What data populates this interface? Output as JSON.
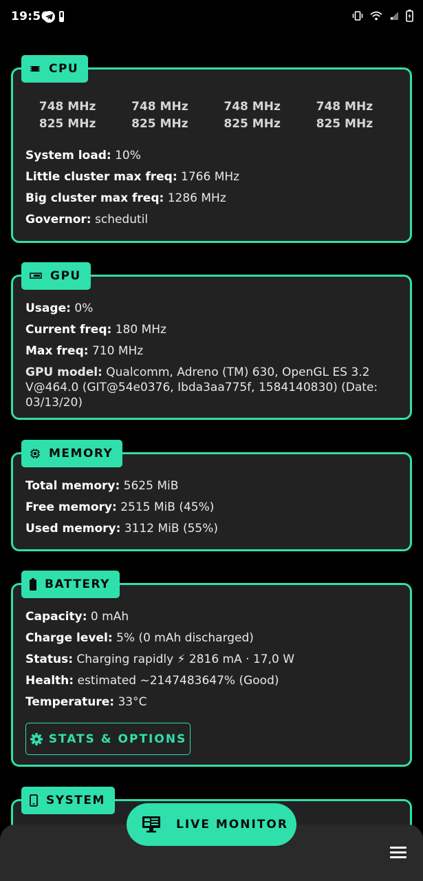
{
  "status_bar": {
    "time": "19:56",
    "icons": [
      "telegram-icon",
      "battery-small-icon",
      "vibrate-icon",
      "wifi-icon",
      "signal-icon",
      "battery-icon"
    ]
  },
  "colors": {
    "accent": "#2fe0ad",
    "card_bg": "#222222",
    "page_bg": "#000000"
  },
  "cpu": {
    "title": "CPU",
    "cores": [
      {
        "cur": "748 MHz",
        "max": "825 MHz"
      },
      {
        "cur": "748 MHz",
        "max": "825 MHz"
      },
      {
        "cur": "748 MHz",
        "max": "825 MHz"
      },
      {
        "cur": "748 MHz",
        "max": "825 MHz"
      }
    ],
    "system_load_label": "System load:",
    "system_load": "10%",
    "little_label": "Little cluster max freq:",
    "little": "1766 MHz",
    "big_label": "Big cluster max freq:",
    "big": "1286 MHz",
    "governor_label": "Governor:",
    "governor": "schedutil"
  },
  "gpu": {
    "title": "GPU",
    "usage_label": "Usage:",
    "usage": "0%",
    "current_label": "Current freq:",
    "current": "180 MHz",
    "max_label": "Max freq:",
    "max": "710 MHz",
    "model_label": "GPU model:",
    "model": "Qualcomm, Adreno (TM) 630, OpenGL ES 3.2 V@464.0 (GIT@54e0376, Ibda3aa775f, 1584140830) (Date: 03/13/20)"
  },
  "memory": {
    "title": "MEMORY",
    "total_label": "Total memory:",
    "total": "5625 MiB",
    "free_label": "Free memory:",
    "free": "2515 MiB (45%)",
    "used_label": "Used memory:",
    "used": "3112 MiB (55%)"
  },
  "battery": {
    "title": "BATTERY",
    "capacity_label": "Capacity:",
    "capacity": "0 mAh",
    "charge_label": "Charge level:",
    "charge": "5% (0 mAh discharged)",
    "status_label": "Status:",
    "status": "Charging rapidly ⚡ 2816 mA · 17,0 W",
    "health_label": "Health:",
    "health": "estimated ~2147483647% (Good)",
    "temp_label": "Temperature:",
    "temp": "33°C",
    "stats_button": "STATS & OPTIONS"
  },
  "system": {
    "title": "SYSTEM"
  },
  "fab": {
    "label": "LIVE MONITOR"
  }
}
